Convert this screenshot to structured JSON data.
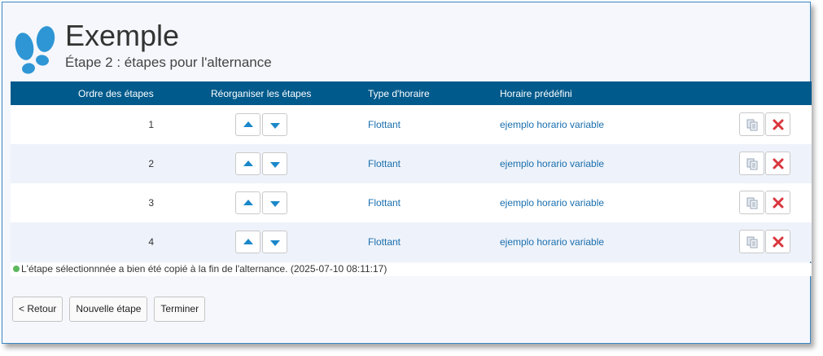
{
  "header": {
    "title": "Exemple",
    "subtitle": "Étape 2 : étapes pour l'alternance"
  },
  "table": {
    "columns": [
      "Ordre des étapes",
      "Réorganiser les étapes",
      "Type d'horaire",
      "Horaire prédéfini"
    ],
    "rows": [
      {
        "order": "1",
        "type": "Flottant",
        "schedule": "ejemplo horario variable"
      },
      {
        "order": "2",
        "type": "Flottant",
        "schedule": "ejemplo horario variable"
      },
      {
        "order": "3",
        "type": "Flottant",
        "schedule": "ejemplo horario variable"
      },
      {
        "order": "4",
        "type": "Flottant",
        "schedule": "ejemplo horario variable"
      }
    ]
  },
  "message": "L'étape sélectionnnée a bien été copié à la fin de l'alternance. (2025-07-10 08:11:17)",
  "buttons": {
    "back": "< Retour",
    "new_step": "Nouvelle étape",
    "finish": "Terminer"
  },
  "colors": {
    "header_bg": "#005a8c",
    "accent": "#1a87c9",
    "delete": "#d9363e",
    "success": "#5cb85c"
  },
  "icons": {
    "logo": "footprints-icon",
    "move_up": "arrow-up-icon",
    "move_down": "arrow-down-icon",
    "copy": "copy-icon",
    "delete": "delete-x-icon"
  }
}
